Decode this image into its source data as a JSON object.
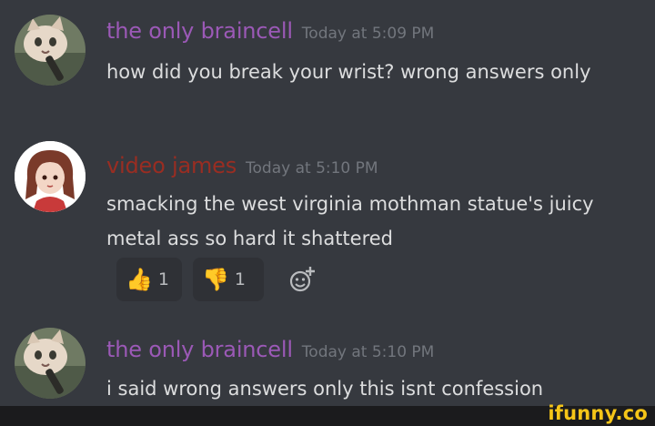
{
  "messages": [
    {
      "username": "the only braincell",
      "username_color": "#9b59b6",
      "timestamp": "Today at 5:09 PM",
      "text": "how did you break your wrist? wrong answers only"
    },
    {
      "username": "video james",
      "username_color": "#992d22",
      "timestamp": "Today at 5:10 PM",
      "text": "smacking the west virginia mothman statue's juicy metal ass so hard it shattered",
      "reactions": [
        {
          "emoji": "👍",
          "icon": "thumbs-up-icon",
          "count": "1"
        },
        {
          "emoji": "👎",
          "icon": "thumbs-down-icon",
          "count": "1"
        }
      ],
      "add_reaction_icon": "add-reaction-icon"
    },
    {
      "username": "the only braincell",
      "username_color": "#9b59b6",
      "timestamp": "Today at 5:10 PM",
      "text": "i said wrong answers only this isnt confession"
    }
  ],
  "watermark": "ifunny.co",
  "colors": {
    "background": "#36393f",
    "text": "#dcddde",
    "timestamp": "#72767d",
    "watermark": "#f5c518"
  }
}
